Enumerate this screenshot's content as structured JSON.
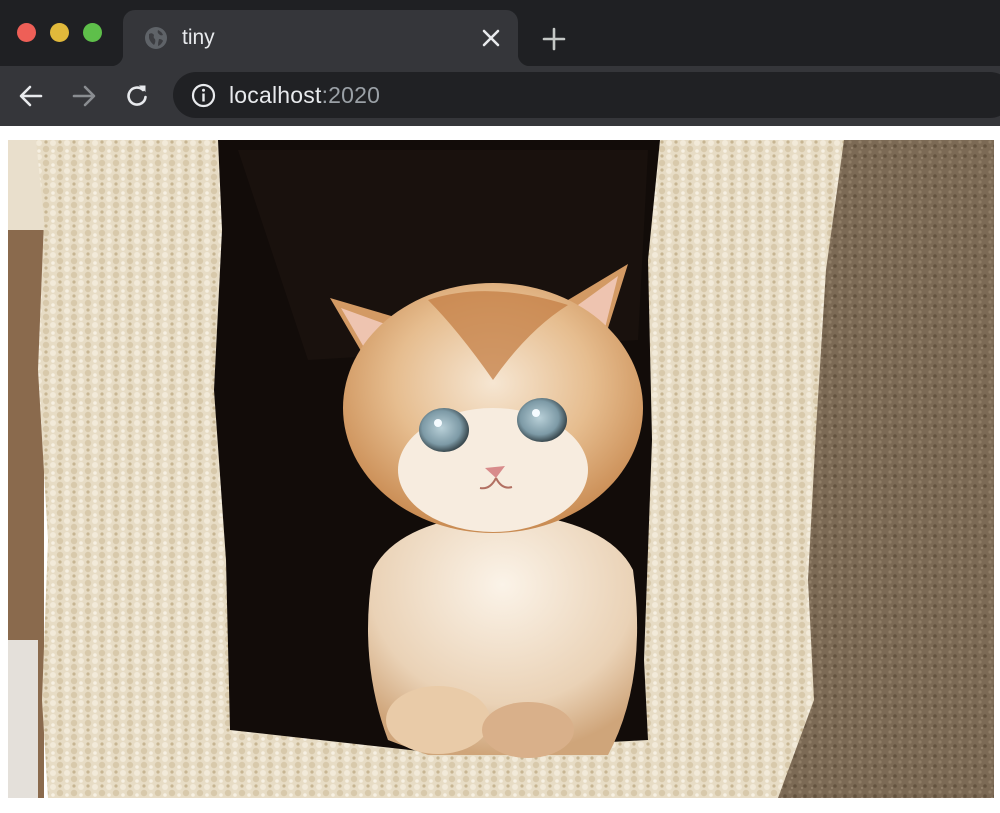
{
  "window": {
    "controls": [
      "close",
      "minimize",
      "maximize"
    ]
  },
  "tab": {
    "title": "tiny",
    "favicon": "globe-icon",
    "close_icon": "close-icon"
  },
  "toolbar": {
    "back_icon": "arrow-left-icon",
    "forward_icon": "arrow-right-icon",
    "reload_icon": "reload-icon",
    "new_tab_icon": "plus-icon"
  },
  "address_bar": {
    "security_icon": "info-icon",
    "host": "localhost",
    "port": ":2020"
  },
  "page": {
    "image_subject": "kitten-in-cat-tree-photo"
  },
  "colors": {
    "titlebar": "#1f2023",
    "tab_active": "#35363a",
    "omnibox": "#202124",
    "traffic_close": "#ee5f57",
    "traffic_minimize": "#e1b93b",
    "traffic_maximize": "#5ebf4a"
  }
}
